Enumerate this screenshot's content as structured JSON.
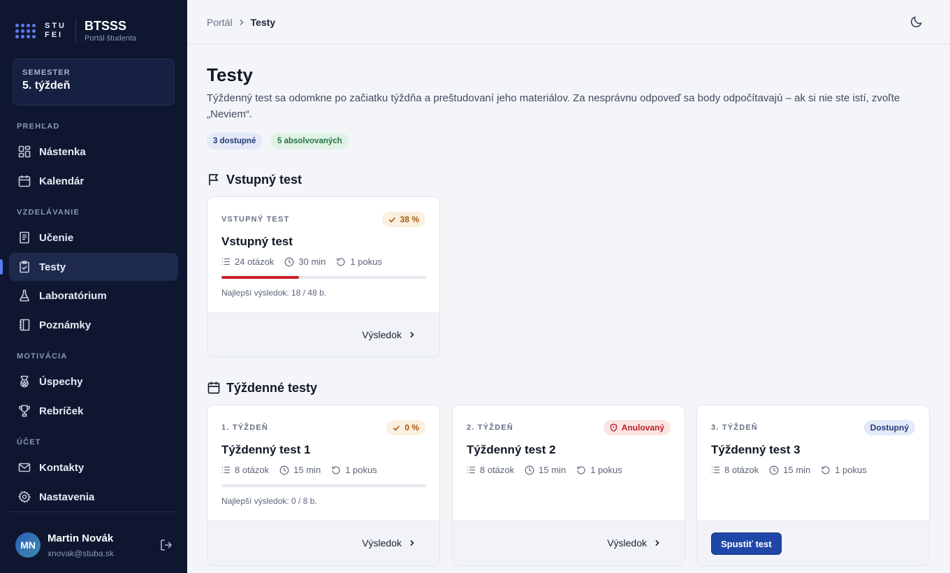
{
  "brand": {
    "logo_text": "STU FEI",
    "title": "BTSSS",
    "subtitle": "Portál študenta"
  },
  "semester": {
    "label": "SEMESTER",
    "value": "5. týždeň"
  },
  "nav": {
    "sections": {
      "overview": "PREHĽAD",
      "learning": "VZDELÁVANIE",
      "motivation": "MOTIVÁCIA",
      "account": "ÚČET"
    },
    "items": {
      "dashboard": "Nástenka",
      "calendar": "Kalendár",
      "learning": "Učenie",
      "tests": "Testy",
      "lab": "Laboratórium",
      "notes": "Poznámky",
      "achievements": "Úspechy",
      "leaderboard": "Rebríček",
      "contacts": "Kontakty",
      "settings": "Nastavenia"
    },
    "active": "tests"
  },
  "user": {
    "initials": "MN",
    "name": "Martin Novák",
    "email": "xnovak@stuba.sk"
  },
  "breadcrumb": {
    "root": "Portál",
    "current": "Testy"
  },
  "page": {
    "title": "Testy",
    "description": "Týždenný test sa odomkne po začiatku týždňa a preštudovaní jeho materiálov. Za nesprávnu odpoveď sa body odpočítavajú – ak si nie ste istí, zvoľte „Neviem“.",
    "pills": {
      "available": "3 dostupné",
      "completed": "5 absolvovaných"
    }
  },
  "sections": {
    "entry": "Vstupný test",
    "weekly": "Týždenné testy"
  },
  "cards": [
    {
      "kicker": "VSTUPNÝ TEST",
      "badge": "38 %",
      "badge_kind": "orange",
      "badge_icon": "check-icon",
      "title": "Vstupný test",
      "questions": "24 otázok",
      "duration": "30 min",
      "attempts": "1 pokus",
      "progress": 0.38,
      "best": "Najlepší výsledok: 18 / 48 b.",
      "action": "Výsledok"
    },
    {
      "kicker": "1. TÝŽDEŇ",
      "badge": "0 %",
      "badge_kind": "orange",
      "badge_icon": "check-icon",
      "title": "Týždenný test 1",
      "questions": "8 otázok",
      "duration": "15 min",
      "attempts": "1 pokus",
      "progress": 0,
      "best": "Najlepší výsledok: 0 / 8 b.",
      "action": "Výsledok"
    },
    {
      "kicker": "2. TÝŽDEŇ",
      "badge": "Anulovaný",
      "badge_kind": "red",
      "badge_icon": "shield-alert-icon",
      "title": "Týždenný test 2",
      "questions": "8 otázok",
      "duration": "15 min",
      "attempts": "1 pokus",
      "action": "Výsledok"
    },
    {
      "kicker": "3. TÝŽDEŇ",
      "badge": "Dostupný",
      "badge_kind": "blue",
      "title": "Týždenný test 3",
      "questions": "8 otázok",
      "duration": "15 min",
      "attempts": "1 pokus",
      "action": "Spustiť test"
    }
  ],
  "colors": {
    "sidebar_bg": "#0f1730",
    "accent": "#5b7cf0",
    "primary_button": "#1f47a8",
    "progress_fill": "#c52026"
  }
}
